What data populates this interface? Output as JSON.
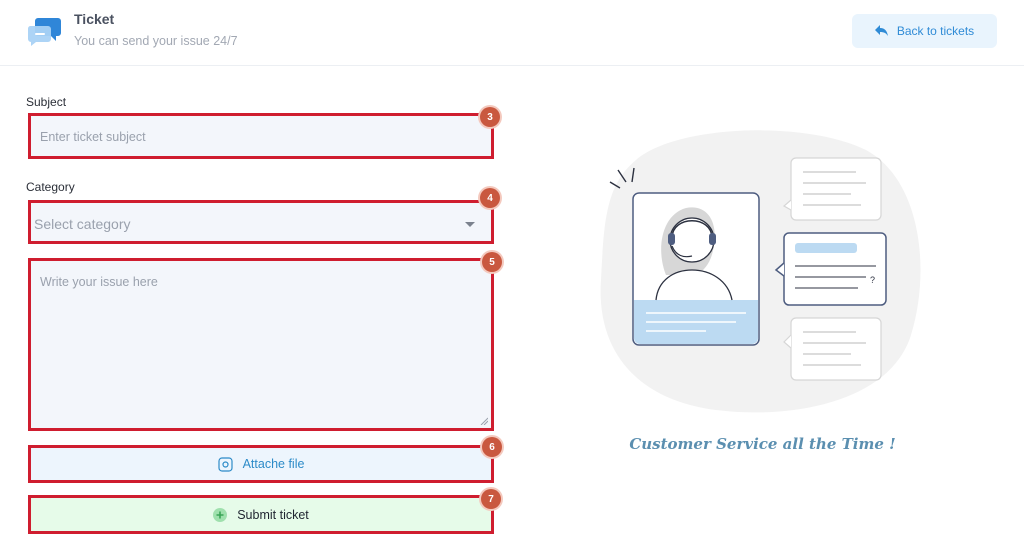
{
  "header": {
    "title": "Ticket",
    "subtitle": "You can send your issue 24/7",
    "back_button": "Back to tickets",
    "logo_icon": "chat-bubbles-icon",
    "back_icon": "reply-arrow-icon"
  },
  "form": {
    "subject_label": "Subject",
    "subject_placeholder": "Enter ticket subject",
    "category_label": "Category",
    "category_placeholder": "Select category",
    "issue_placeholder": "Write your issue here",
    "attach_label": "Attache file",
    "submit_label": "Submit ticket"
  },
  "badges": [
    "3",
    "4",
    "5",
    "6",
    "7"
  ],
  "illustration": {
    "tagline": "Customer Service all the Time !",
    "question_mark": "?"
  },
  "colors": {
    "highlight_border": "#cf1d2f",
    "badge": "#c9583f",
    "accent_blue": "#2f8bd6",
    "submit_bg": "#e6fbe9",
    "attach_bg": "#edf5fd"
  }
}
